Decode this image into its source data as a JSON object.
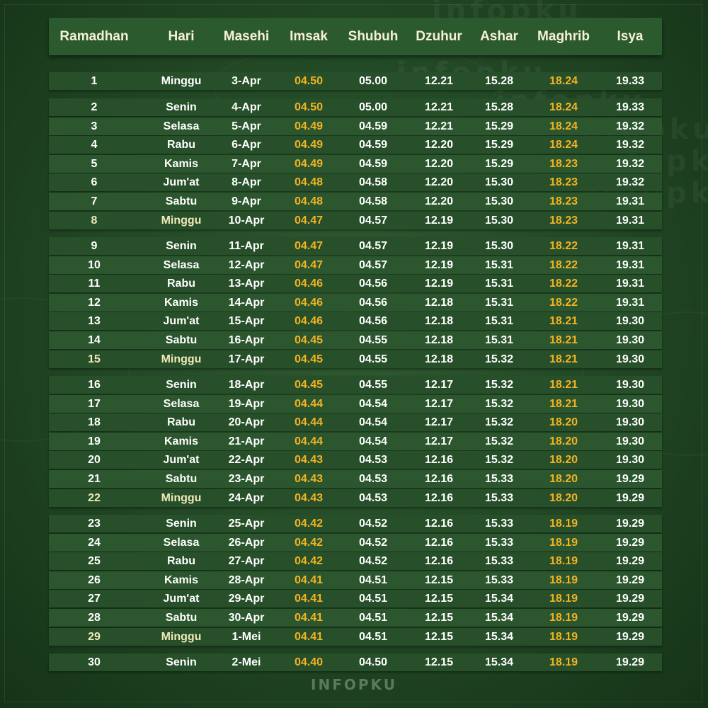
{
  "columns": [
    "Ramadhan",
    "Hari",
    "Masehi",
    "Imsak",
    "Shubuh",
    "Dzuhur",
    "Ashar",
    "Maghrib",
    "Isya"
  ],
  "colors": {
    "accent_gold": "#f3b323",
    "header_text": "#f6f1d6",
    "row_bg": "#274f2a",
    "bg": "#234a26"
  },
  "watermark": "infopku",
  "footer": "INFOPKU",
  "groups": [
    {
      "rows": [
        [
          "1",
          "Minggu",
          "3-Apr",
          "04.50",
          "05.00",
          "12.21",
          "15.28",
          "18.24",
          "19.33"
        ]
      ]
    },
    {
      "rows": [
        [
          "2",
          "Senin",
          "4-Apr",
          "04.50",
          "05.00",
          "12.21",
          "15.28",
          "18.24",
          "19.33"
        ],
        [
          "3",
          "Selasa",
          "5-Apr",
          "04.49",
          "04.59",
          "12.21",
          "15.29",
          "18.24",
          "19.32"
        ],
        [
          "4",
          "Rabu",
          "6-Apr",
          "04.49",
          "04.59",
          "12.20",
          "15.29",
          "18.24",
          "19.32"
        ],
        [
          "5",
          "Kamis",
          "7-Apr",
          "04.49",
          "04.59",
          "12.20",
          "15.29",
          "18.23",
          "19.32"
        ],
        [
          "6",
          "Jum'at",
          "8-Apr",
          "04.48",
          "04.58",
          "12.20",
          "15.30",
          "18.23",
          "19.32"
        ],
        [
          "7",
          "Sabtu",
          "9-Apr",
          "04.48",
          "04.58",
          "12.20",
          "15.30",
          "18.23",
          "19.31"
        ],
        [
          "8",
          "Minggu",
          "10-Apr",
          "04.47",
          "04.57",
          "12.19",
          "15.30",
          "18.23",
          "19.31"
        ]
      ]
    },
    {
      "rows": [
        [
          "9",
          "Senin",
          "11-Apr",
          "04.47",
          "04.57",
          "12.19",
          "15.30",
          "18.22",
          "19.31"
        ],
        [
          "10",
          "Selasa",
          "12-Apr",
          "04.47",
          "04.57",
          "12.19",
          "15.31",
          "18.22",
          "19.31"
        ],
        [
          "11",
          "Rabu",
          "13-Apr",
          "04.46",
          "04.56",
          "12.19",
          "15.31",
          "18.22",
          "19.31"
        ],
        [
          "12",
          "Kamis",
          "14-Apr",
          "04.46",
          "04.56",
          "12.18",
          "15.31",
          "18.22",
          "19.31"
        ],
        [
          "13",
          "Jum'at",
          "15-Apr",
          "04.46",
          "04.56",
          "12.18",
          "15.31",
          "18.21",
          "19.30"
        ],
        [
          "14",
          "Sabtu",
          "16-Apr",
          "04.45",
          "04.55",
          "12.18",
          "15.31",
          "18.21",
          "19.30"
        ],
        [
          "15",
          "Minggu",
          "17-Apr",
          "04.45",
          "04.55",
          "12.18",
          "15.32",
          "18.21",
          "19.30"
        ]
      ]
    },
    {
      "rows": [
        [
          "16",
          "Senin",
          "18-Apr",
          "04.45",
          "04.55",
          "12.17",
          "15.32",
          "18.21",
          "19.30"
        ],
        [
          "17",
          "Selasa",
          "19-Apr",
          "04.44",
          "04.54",
          "12.17",
          "15.32",
          "18.21",
          "19.30"
        ],
        [
          "18",
          "Rabu",
          "20-Apr",
          "04.44",
          "04.54",
          "12.17",
          "15.32",
          "18.20",
          "19.30"
        ],
        [
          "19",
          "Kamis",
          "21-Apr",
          "04.44",
          "04.54",
          "12.17",
          "15.32",
          "18.20",
          "19.30"
        ],
        [
          "20",
          "Jum'at",
          "22-Apr",
          "04.43",
          "04.53",
          "12.16",
          "15.32",
          "18.20",
          "19.30"
        ],
        [
          "21",
          "Sabtu",
          "23-Apr",
          "04.43",
          "04.53",
          "12.16",
          "15.33",
          "18.20",
          "19.29"
        ],
        [
          "22",
          "Minggu",
          "24-Apr",
          "04.43",
          "04.53",
          "12.16",
          "15.33",
          "18.20",
          "19.29"
        ]
      ]
    },
    {
      "rows": [
        [
          "23",
          "Senin",
          "25-Apr",
          "04.42",
          "04.52",
          "12.16",
          "15.33",
          "18.19",
          "19.29"
        ],
        [
          "24",
          "Selasa",
          "26-Apr",
          "04.42",
          "04.52",
          "12.16",
          "15.33",
          "18.19",
          "19.29"
        ],
        [
          "25",
          "Rabu",
          "27-Apr",
          "04.42",
          "04.52",
          "12.16",
          "15.33",
          "18.19",
          "19.29"
        ],
        [
          "26",
          "Kamis",
          "28-Apr",
          "04.41",
          "04.51",
          "12.15",
          "15.33",
          "18.19",
          "19.29"
        ],
        [
          "27",
          "Jum'at",
          "29-Apr",
          "04.41",
          "04.51",
          "12.15",
          "15.34",
          "18.19",
          "19.29"
        ],
        [
          "28",
          "Sabtu",
          "30-Apr",
          "04.41",
          "04.51",
          "12.15",
          "15.34",
          "18.19",
          "19.29"
        ],
        [
          "29",
          "Minggu",
          "1-Mei",
          "04.41",
          "04.51",
          "12.15",
          "15.34",
          "18.19",
          "19.29"
        ]
      ]
    },
    {
      "rows": [
        [
          "30",
          "Senin",
          "2-Mei",
          "04.40",
          "04.50",
          "12.15",
          "15.34",
          "18.19",
          "19.29"
        ]
      ]
    }
  ]
}
